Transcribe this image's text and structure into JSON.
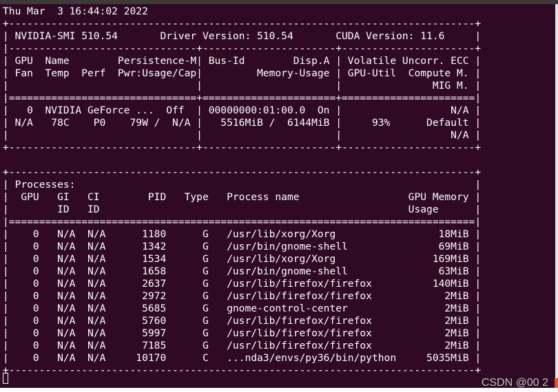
{
  "terminal": {
    "lines": [
      "Thu Mar  3 16:44:02 2022",
      "+-----------------------------------------------------------------------------+",
      "| NVIDIA-SMI 510.54       Driver Version: 510.54       CUDA Version: 11.6     |",
      "|-------------------------------+----------------------+----------------------+",
      "| GPU  Name        Persistence-M| Bus-Id        Disp.A | Volatile Uncorr. ECC |",
      "| Fan  Temp  Perf  Pwr:Usage/Cap|         Memory-Usage | GPU-Util  Compute M. |",
      "|                               |                      |               MIG M. |",
      "|===============================+======================+======================|",
      "|   0  NVIDIA GeForce ...  Off  | 00000000:01:00.0  On |                  N/A |",
      "| N/A   78C    P0    79W /  N/A |   5516MiB /  6144MiB |     93%      Default |",
      "|                               |                      |                  N/A |",
      "+-------------------------------+----------------------+----------------------+",
      "",
      "+-----------------------------------------------------------------------------+",
      "| Processes:                                                                  |",
      "|  GPU   GI   CI        PID   Type   Process name                  GPU Memory |",
      "|        ID   ID                                                   Usage      |",
      "|=============================================================================|",
      "|    0   N/A  N/A      1180      G   /usr/lib/xorg/Xorg                 18MiB |",
      "|    0   N/A  N/A      1342      G   /usr/bin/gnome-shell               69MiB |",
      "|    0   N/A  N/A      1534      G   /usr/lib/xorg/Xorg                169MiB |",
      "|    0   N/A  N/A      1658      G   /usr/bin/gnome-shell               63MiB |",
      "|    0   N/A  N/A      2637      G   /usr/lib/firefox/firefox          140MiB |",
      "|    0   N/A  N/A      2972      G   /usr/lib/firefox/firefox            2MiB |",
      "|    0   N/A  N/A      5685      G   gnome-control-center                2MiB |",
      "|    0   N/A  N/A      5760      G   /usr/lib/firefox/firefox            2MiB |",
      "|    0   N/A  N/A      5997      G   /usr/lib/firefox/firefox            2MiB |",
      "|    0   N/A  N/A      7185      G   /usr/lib/firefox/firefox            2MiB |",
      "|    0   N/A  N/A     10170      C   ...nda3/envs/py36/bin/python     5035MiB |",
      "+-----------------------------------------------------------------------------+"
    ]
  },
  "watermark": "CSDN @00 2",
  "colors": {
    "background": "#300a24",
    "foreground": "#ffffff"
  }
}
